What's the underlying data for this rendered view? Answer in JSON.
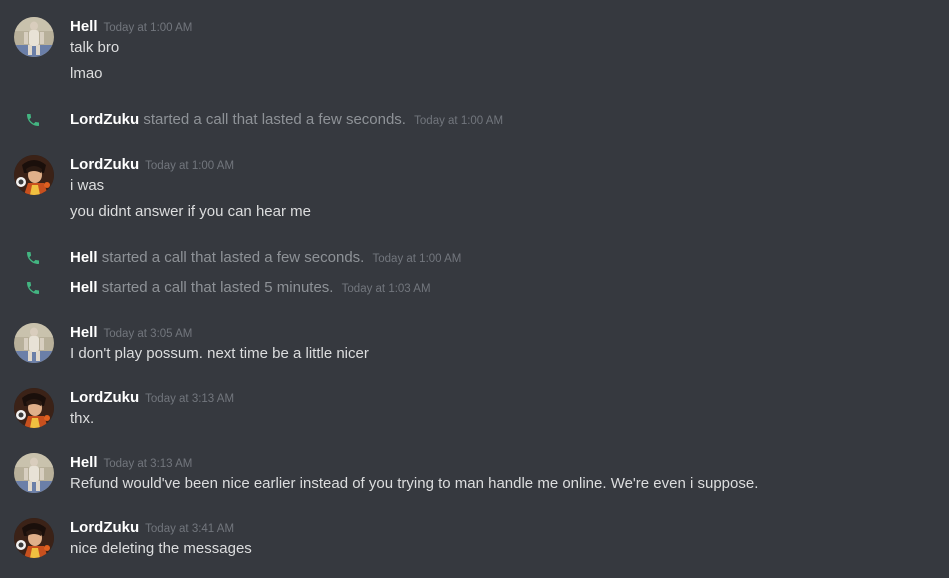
{
  "colors": {
    "background": "#36393f",
    "username": "#ffffff",
    "message_text": "#dcddde",
    "timestamp": "#72767d",
    "system_text": "#8e9297",
    "call_icon": "#43b581"
  },
  "messages": [
    {
      "author": "Hell",
      "avatar": "hell-avatar",
      "timestamp": "Today at 1:00 AM",
      "lines": [
        "talk bro",
        "lmao"
      ]
    },
    {
      "author": "LordZuku",
      "avatar": "lordzuku-avatar",
      "timestamp": "Today at 1:00 AM",
      "lines": [
        "i was",
        "you didnt answer if you can hear me"
      ]
    },
    {
      "author": "Hell",
      "avatar": "hell-avatar",
      "timestamp": "Today at 3:05 AM",
      "lines": [
        "I don't play possum. next time be a little nicer"
      ]
    },
    {
      "author": "LordZuku",
      "avatar": "lordzuku-avatar",
      "timestamp": "Today at 3:13 AM",
      "lines": [
        "thx."
      ]
    },
    {
      "author": "Hell",
      "avatar": "hell-avatar",
      "timestamp": "Today at 3:13 AM",
      "lines": [
        "Refund would've been nice earlier instead of you trying to man handle me online. We're even i suppose."
      ]
    },
    {
      "author": "LordZuku",
      "avatar": "lordzuku-avatar",
      "timestamp": "Today at 3:41 AM",
      "lines": [
        "nice deleting the messages"
      ]
    }
  ],
  "calls": [
    {
      "icon": "phone-icon",
      "actor": "LordZuku",
      "text": "started a call that lasted a few seconds.",
      "timestamp": "Today at 1:00 AM"
    },
    {
      "icon": "phone-icon",
      "actor": "Hell",
      "text": "started a call that lasted a few seconds.",
      "timestamp": "Today at 1:00 AM"
    },
    {
      "icon": "phone-icon",
      "actor": "Hell",
      "text": "started a call that lasted 5 minutes.",
      "timestamp": "Today at 1:03 AM"
    }
  ]
}
